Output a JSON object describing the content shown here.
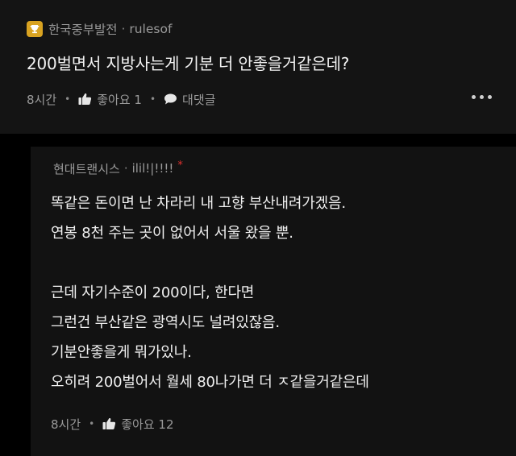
{
  "post": {
    "company": "한국중부발전",
    "nickname": "rulesof",
    "separator": "·",
    "body": "200벌면서 지방사는게 기분 더 안좋을거같은데?",
    "time": "8시간",
    "like_label": "좋아요 1",
    "comment_label": "대댓글",
    "meta_sep": "•",
    "icons": [
      "trophy-icon",
      "thumbs-up-icon",
      "speech-bubble-icon",
      "more-dots-icon"
    ]
  },
  "reply": {
    "company": "현대트랜시스",
    "nickname": "ilil!|!!!!",
    "separator": "·",
    "author_mark": "*",
    "lines": [
      "똑같은 돈이면 난 차라리 내 고향 부산내려가겠음.",
      "연봉 8천 주는 곳이 없어서 서울 왔을 뿐.",
      "",
      "근데 자기수준이 200이다, 한다면",
      "그런건 부산같은 광역시도 널려있잖음.",
      "기분안좋을게 뭐가있나.",
      "오히려 200벌어서 월세 80나가면 더 ㅈ같을거같은데"
    ],
    "time": "8시간",
    "like_label": "좋아요 12",
    "meta_sep": "•",
    "icons": [
      "thumbs-up-icon"
    ]
  },
  "colors": {
    "background": "#000000",
    "post_bg": "#141414",
    "reply_bg": "#121212",
    "trophy": "#d9a321",
    "author_mark": "#e0312f",
    "muted_text": "#9a9a9a",
    "body_text": "#f0f0f0"
  }
}
